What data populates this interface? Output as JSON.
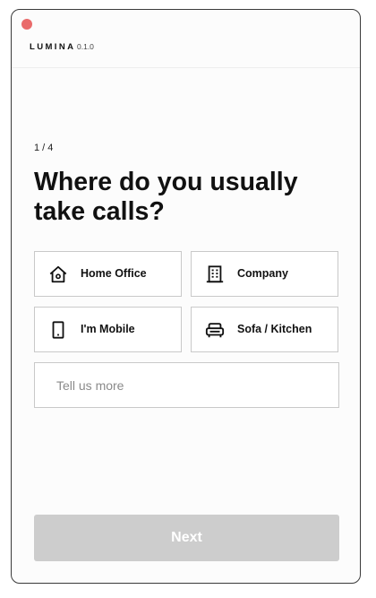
{
  "app": {
    "brand": "LUMINA",
    "version": "0.1.0"
  },
  "colors": {
    "close_dot": "#e96b6b",
    "next_disabled": "#cdcdcd"
  },
  "onboarding": {
    "step": "1 / 4",
    "question": "Where do you usually take calls?",
    "options": [
      {
        "label": "Home Office",
        "icon": "home-icon"
      },
      {
        "label": "Company",
        "icon": "building-icon"
      },
      {
        "label": "I'm Mobile",
        "icon": "phone-icon"
      },
      {
        "label": "Sofa / Kitchen",
        "icon": "sofa-icon"
      }
    ],
    "more": {
      "placeholder": "Tell us more",
      "value": ""
    },
    "next_label": "Next"
  }
}
